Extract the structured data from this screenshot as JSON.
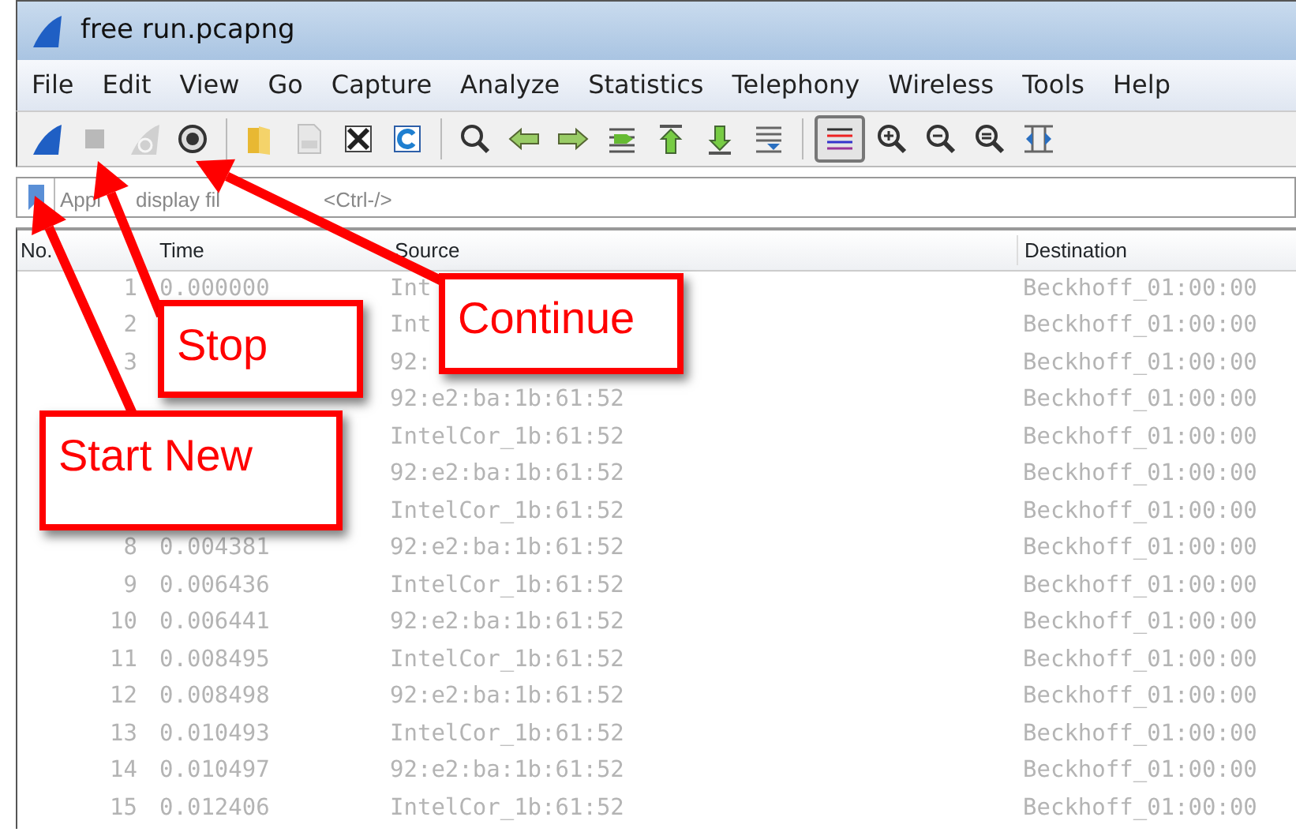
{
  "window": {
    "title": "free run.pcapng"
  },
  "menu": [
    "File",
    "Edit",
    "View",
    "Go",
    "Capture",
    "Analyze",
    "Statistics",
    "Telephony",
    "Wireless",
    "Tools",
    "Help"
  ],
  "toolbar": [
    {
      "kind": "start",
      "disabled": false,
      "selected": false
    },
    {
      "kind": "stop",
      "disabled": true,
      "selected": false
    },
    {
      "kind": "restart",
      "disabled": true,
      "selected": false
    },
    {
      "kind": "options",
      "disabled": false,
      "selected": false
    },
    {
      "kind": "separator"
    },
    {
      "kind": "open",
      "disabled": false,
      "selected": false
    },
    {
      "kind": "save",
      "disabled": true,
      "selected": false
    },
    {
      "kind": "close",
      "disabled": false,
      "selected": false
    },
    {
      "kind": "reload",
      "disabled": false,
      "selected": false
    },
    {
      "kind": "separator"
    },
    {
      "kind": "find",
      "disabled": false,
      "selected": false
    },
    {
      "kind": "back",
      "disabled": false,
      "selected": false
    },
    {
      "kind": "forward",
      "disabled": false,
      "selected": false
    },
    {
      "kind": "goto",
      "disabled": false,
      "selected": false
    },
    {
      "kind": "first",
      "disabled": false,
      "selected": false
    },
    {
      "kind": "last",
      "disabled": false,
      "selected": false
    },
    {
      "kind": "autoscroll",
      "disabled": false,
      "selected": false
    },
    {
      "kind": "separator"
    },
    {
      "kind": "colorize",
      "disabled": false,
      "selected": true
    },
    {
      "kind": "zoom_in",
      "disabled": false,
      "selected": false
    },
    {
      "kind": "zoom_out",
      "disabled": false,
      "selected": false
    },
    {
      "kind": "zoom_reset",
      "disabled": false,
      "selected": false
    },
    {
      "kind": "resize",
      "disabled": false,
      "selected": false
    }
  ],
  "filter": {
    "placeholder_fragments": [
      "Appl",
      "display fil",
      "<Ctrl-/>"
    ]
  },
  "table": {
    "columns": [
      "No.",
      "Time",
      "Source",
      "Destination"
    ],
    "rows": [
      {
        "no": "1",
        "time": "0.000000",
        "source": "Int",
        "destination": "Beckhoff_01:00:00"
      },
      {
        "no": "2",
        "source": "Int",
        "destination": "Beckhoff_01:00:00"
      },
      {
        "no": "3",
        "source": "92:",
        "destination": "Beckhoff_01:00:00"
      },
      {
        "source": "92:e2:ba:1b:61:52",
        "destination": "Beckhoff_01:00:00"
      },
      {
        "source": "IntelCor_1b:61:52",
        "destination": "Beckhoff_01:00:00"
      },
      {
        "source": "92:e2:ba:1b:61:52",
        "destination": "Beckhoff_01:00:00"
      },
      {
        "source": "IntelCor_1b:61:52",
        "destination": "Beckhoff_01:00:00"
      },
      {
        "no": "8",
        "time": "0.004381",
        "source": "92:e2:ba:1b:61:52",
        "destination": "Beckhoff_01:00:00"
      },
      {
        "no": "9",
        "time": "0.006436",
        "source": "IntelCor_1b:61:52",
        "destination": "Beckhoff_01:00:00"
      },
      {
        "no": "10",
        "time": "0.006441",
        "source": "92:e2:ba:1b:61:52",
        "destination": "Beckhoff_01:00:00"
      },
      {
        "no": "11",
        "time": "0.008495",
        "source": "IntelCor_1b:61:52",
        "destination": "Beckhoff_01:00:00"
      },
      {
        "no": "12",
        "time": "0.008498",
        "source": "92:e2:ba:1b:61:52",
        "destination": "Beckhoff_01:00:00"
      },
      {
        "no": "13",
        "time": "0.010493",
        "source": "IntelCor_1b:61:52",
        "destination": "Beckhoff_01:00:00"
      },
      {
        "no": "14",
        "time": "0.010497",
        "source": "92:e2:ba:1b:61:52",
        "destination": "Beckhoff_01:00:00"
      },
      {
        "no": "15",
        "time": "0.012406",
        "source": "IntelCor_1b:61:52",
        "destination": "Beckhoff_01:00:00"
      }
    ]
  },
  "annotations": [
    {
      "text": "Continue"
    },
    {
      "text": "Stop"
    },
    {
      "text": "Start New"
    }
  ]
}
